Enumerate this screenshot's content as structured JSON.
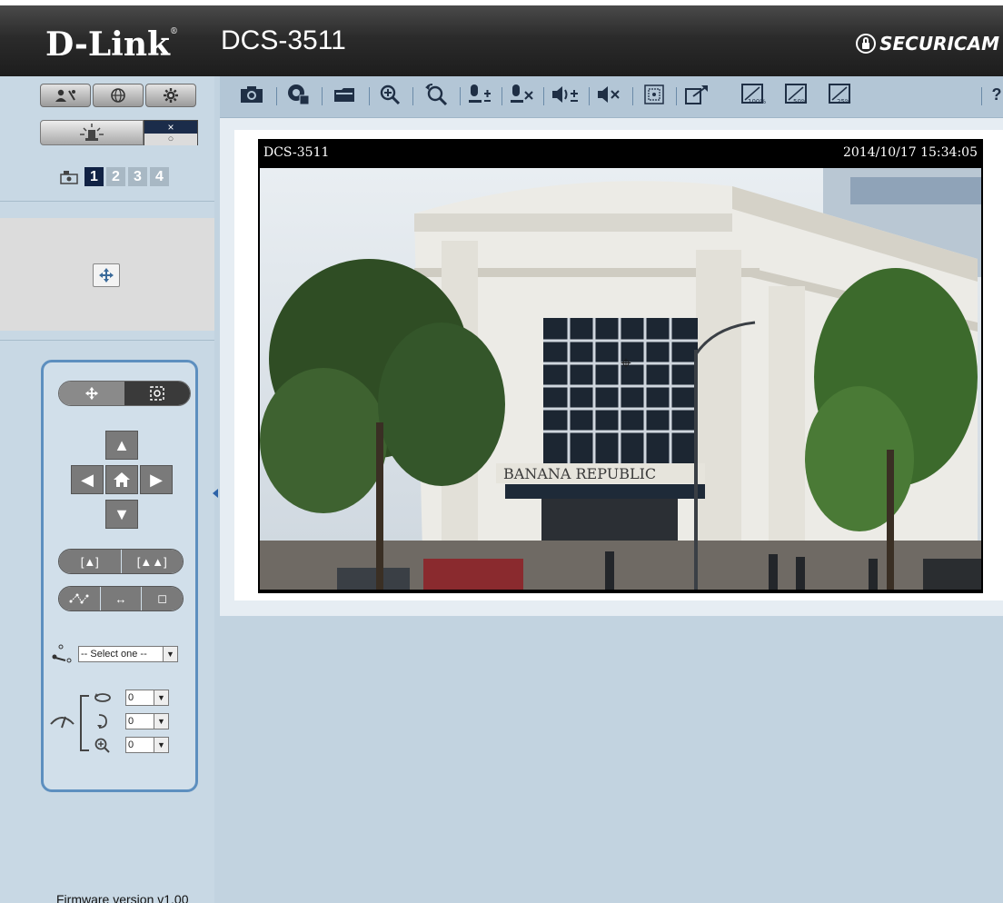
{
  "header": {
    "brand": "D-Link",
    "brand_mark": "®",
    "model": "DCS-3511",
    "product_line": "SECURICAM",
    "bg_color": "#2b2b2b"
  },
  "sidebar": {
    "top_icons": [
      "user-setup-icon",
      "network-globe-icon",
      "settings-gear-icon"
    ],
    "alarm": {
      "icon": "alarm-siren-icon",
      "toggle_on": "×",
      "toggle_off": "○"
    },
    "channels": [
      "1",
      "2",
      "3",
      "4"
    ],
    "active_channel": "1",
    "ptz": {
      "mode_buttons": [
        "pan-move-icon",
        "zoom-box-icon"
      ],
      "zoom_buttons": [
        "[▲]",
        "[▲▲]"
      ],
      "path_buttons": [
        "path-icon",
        "↔",
        "◻"
      ],
      "preset_placeholder": "-- Select one --",
      "speeds": {
        "pan_value": "0",
        "tilt_value": "0",
        "zoom_value": "0"
      }
    }
  },
  "footer": {
    "firmware": "Firmware version v1.00"
  },
  "toolbar": {
    "items": [
      "snapshot-icon",
      "record-icon",
      "folder-icon",
      "digital-zoom-icon",
      "zoom-reset-icon",
      "mic-volume-icon",
      "mic-mute-icon",
      "speaker-volume-icon",
      "speaker-mute-icon",
      "fullscreen-icon",
      "resize-icon",
      "size-100-icon",
      "size-50-icon",
      "size-25-icon",
      "help-icon"
    ]
  },
  "video": {
    "camera_name": "DCS-3511",
    "timestamp": "2014/10/17 15:34:05",
    "store_sign": "BANANA REPUBLIC"
  }
}
